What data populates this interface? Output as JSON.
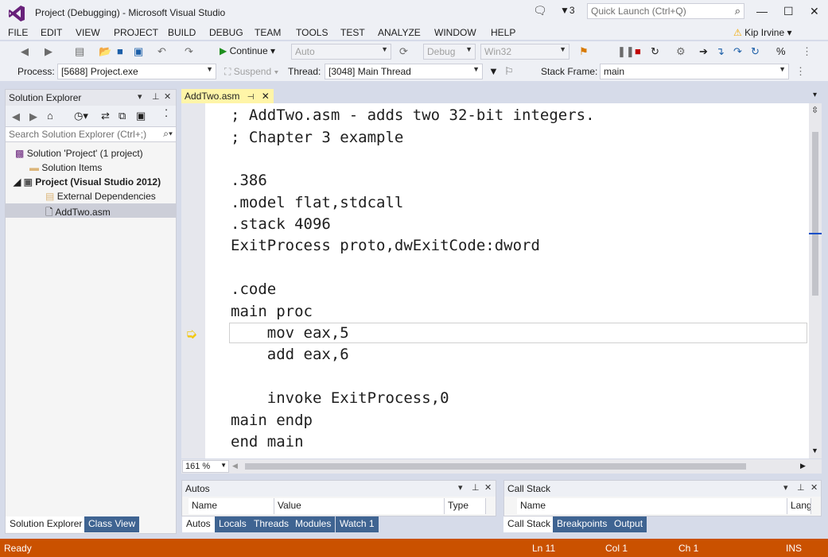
{
  "window": {
    "title": "Project (Debugging) - Microsoft Visual Studio",
    "notification_count": "3",
    "quick_launch_placeholder": "Quick Launch (Ctrl+Q)",
    "minimize": "—",
    "maximize": "☐",
    "close": "✕"
  },
  "menu": [
    "FILE",
    "EDIT",
    "VIEW",
    "PROJECT",
    "BUILD",
    "DEBUG",
    "TEAM",
    "TOOLS",
    "TEST",
    "ANALYZE",
    "WINDOW",
    "HELP"
  ],
  "user": {
    "name": "Kip Irvine"
  },
  "toolbar": {
    "continue_label": "Continue",
    "config_auto": "Auto",
    "config_debug": "Debug",
    "platform": "Win32"
  },
  "debug_location": {
    "process_label": "Process:",
    "process_value": "[5688] Project.exe",
    "suspend_label": "Suspend",
    "thread_label": "Thread:",
    "thread_value": "[3048] Main Thread",
    "stackframe_label": "Stack Frame:",
    "stackframe_value": "main"
  },
  "solution_explorer": {
    "title": "Solution Explorer",
    "search_placeholder": "Search Solution Explorer (Ctrl+;)",
    "items": [
      {
        "label": "Solution 'Project' (1 project)"
      },
      {
        "label": "Solution Items"
      },
      {
        "label": "Project (Visual Studio 2012)"
      },
      {
        "label": "External Dependencies"
      },
      {
        "label": "AddTwo.asm"
      }
    ],
    "tabs": [
      "Solution Explorer",
      "Class View"
    ]
  },
  "editor": {
    "tab_label": "AddTwo.asm",
    "zoom": "161 %",
    "lines": [
      "; AddTwo.asm - adds two 32-bit integers.",
      "; Chapter 3 example",
      "",
      ".386",
      ".model flat,stdcall",
      ".stack 4096",
      "ExitProcess proto,dwExitCode:dword",
      "",
      ".code",
      "main proc",
      "    mov eax,5",
      "    add eax,6",
      "",
      "    invoke ExitProcess,0",
      "main endp",
      "end main"
    ]
  },
  "autos": {
    "title": "Autos",
    "columns": [
      "Name",
      "Value",
      "Type"
    ],
    "tabs": [
      "Autos",
      "Locals",
      "Threads",
      "Modules",
      "Watch 1"
    ]
  },
  "callstack": {
    "title": "Call Stack",
    "columns": [
      "Name",
      "Lang"
    ],
    "tabs": [
      "Call Stack",
      "Breakpoints",
      "Output"
    ]
  },
  "status": {
    "state": "Ready",
    "line": "Ln 11",
    "col": "Col 1",
    "ch": "Ch 1",
    "mode": "INS"
  },
  "colors": {
    "accent": "#68217a",
    "status_bar": "#ca5100",
    "active_tab": "#fff5a8",
    "tab_bar": "#3f6492"
  }
}
